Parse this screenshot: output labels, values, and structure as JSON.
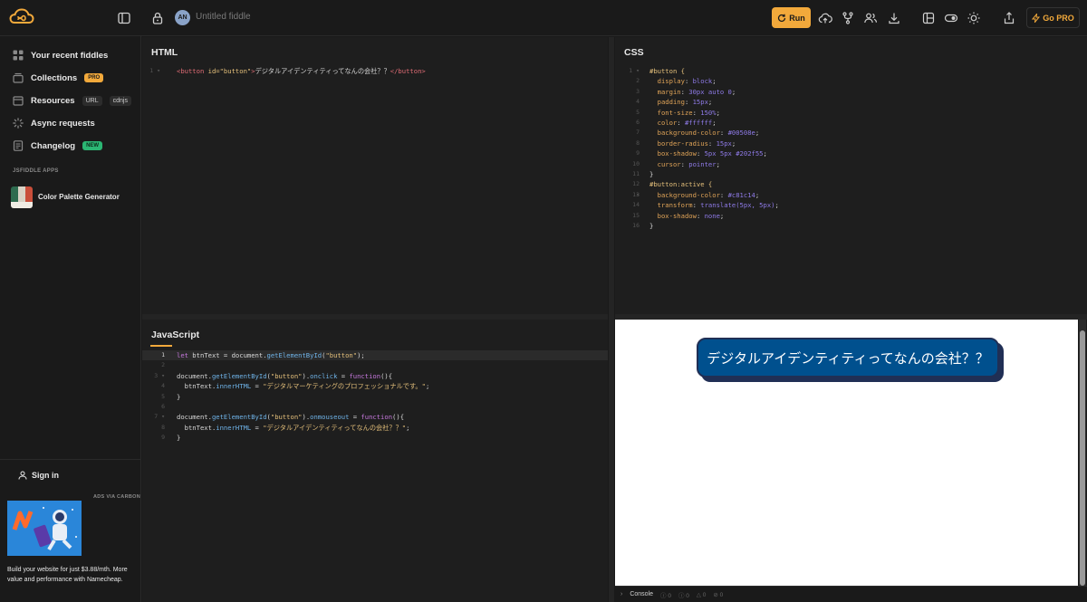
{
  "topbar": {
    "fiddle_title": "Untitled fiddle",
    "avatar_initials": "AN",
    "run_label": "Run",
    "gopro_label": "Go PRO",
    "accent": "#f2a93b"
  },
  "sidebar": {
    "items": [
      {
        "label": "Your recent fiddles",
        "icon": "grid-icon"
      },
      {
        "label": "Collections",
        "icon": "archive-icon",
        "tag": "PRO"
      },
      {
        "label": "Resources",
        "icon": "box-icon",
        "tags": [
          "URL",
          "cdnjs"
        ]
      },
      {
        "label": "Async requests",
        "icon": "spinner-icon"
      },
      {
        "label": "Changelog",
        "icon": "document-icon",
        "tag": "NEW"
      }
    ],
    "apps_heading": "JSFIDDLE APPS",
    "app_name": "Color Palette Generator",
    "signin_label": "Sign in",
    "ads_label": "ADS VIA CARBON",
    "ad_text": "Build your website for just $3.88/mth. More value and performance with Namecheap."
  },
  "panels": {
    "html_title": "HTML",
    "css_title": "CSS",
    "js_title": "JavaScript"
  },
  "html_code": {
    "open_tag": "<button",
    "attr": " id=",
    "attr_value": "\"button\"",
    "close_open": ">",
    "text": "デジタルアイデンティティってなんの会社？？",
    "close_tag": "</button",
    "end": ">"
  },
  "css_lines": [
    "#button {",
    "  display: block;",
    "  margin: 30px auto 0;",
    "  padding: 15px;",
    "  font-size: 150%;",
    "  color: #ffffff;",
    "  background-color: #00508e;",
    "  border-radius: 15px;",
    "  box-shadow: 5px 5px #202f55;",
    "  cursor: pointer;",
    "}",
    "#button:active {",
    "  background-color: #c81c14;",
    "  transform: translate(5px, 5px);",
    "  box-shadow: none;",
    "}"
  ],
  "js_lines": [
    "let btnText = document.getElementById(\"button\");",
    "",
    "document.getElementById(\"button\").onclick = function(){",
    "  btnText.innerHTML = \"デジタルマーケティングのプロフェッショナルです。\";",
    "}",
    "",
    "document.getElementById(\"button\").onmouseout = function(){",
    "  btnText.innerHTML = \"デジタルアイデンティティってなんの会社？？\";",
    "}"
  ],
  "result": {
    "button_text": "デジタルアイデンティティってなんの会社？？",
    "button_color": "#00508e",
    "shadow_color": "#202f55"
  },
  "console": {
    "label": "Console",
    "counts": [
      "0",
      "0",
      "0",
      "0"
    ]
  }
}
